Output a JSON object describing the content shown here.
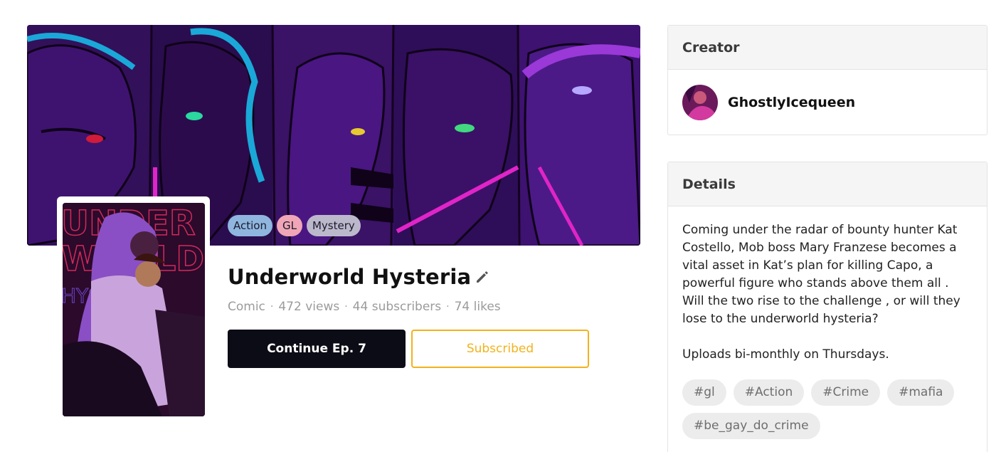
{
  "series": {
    "genres": [
      {
        "label": "Action",
        "color": "#8fb6de"
      },
      {
        "label": "GL",
        "color": "#f0a6b6"
      },
      {
        "label": "Mystery",
        "color": "#bcb8cc"
      }
    ],
    "title": "Underworld Hysteria",
    "edit_icon": "pencil-icon",
    "stats": {
      "type": "Comic",
      "views": "472 views",
      "subscribers": "44 subscribers",
      "likes": "74 likes",
      "separator": "·"
    },
    "continue_label": "Continue Ep. 7",
    "subscribe_label": "Subscribed",
    "cover_text": [
      "UNDER",
      "WORLD",
      "HYSTERIA"
    ]
  },
  "creator": {
    "header": "Creator",
    "name": "GhostlyIcequeen"
  },
  "details": {
    "header": "Details",
    "description": "Coming under the radar of bounty hunter Kat Costello, Mob boss Mary Franzese becomes a vital asset in Kat’s plan for killing Capo, a powerful figure who stands above them all . Will the two rise to the challenge , or will they lose to the underworld hysteria?",
    "schedule": "Uploads bi-monthly on Thursdays.",
    "tags": [
      "#gl",
      "#Action",
      "#Crime",
      "#mafia",
      "#be_gay_do_crime"
    ]
  },
  "colors": {
    "accent": "#f2b21c",
    "button_dark": "#0c0c16",
    "banner_purple": "#3b0f66",
    "neon_pink": "#e024c8",
    "neon_cyan": "#1aa8d8"
  }
}
